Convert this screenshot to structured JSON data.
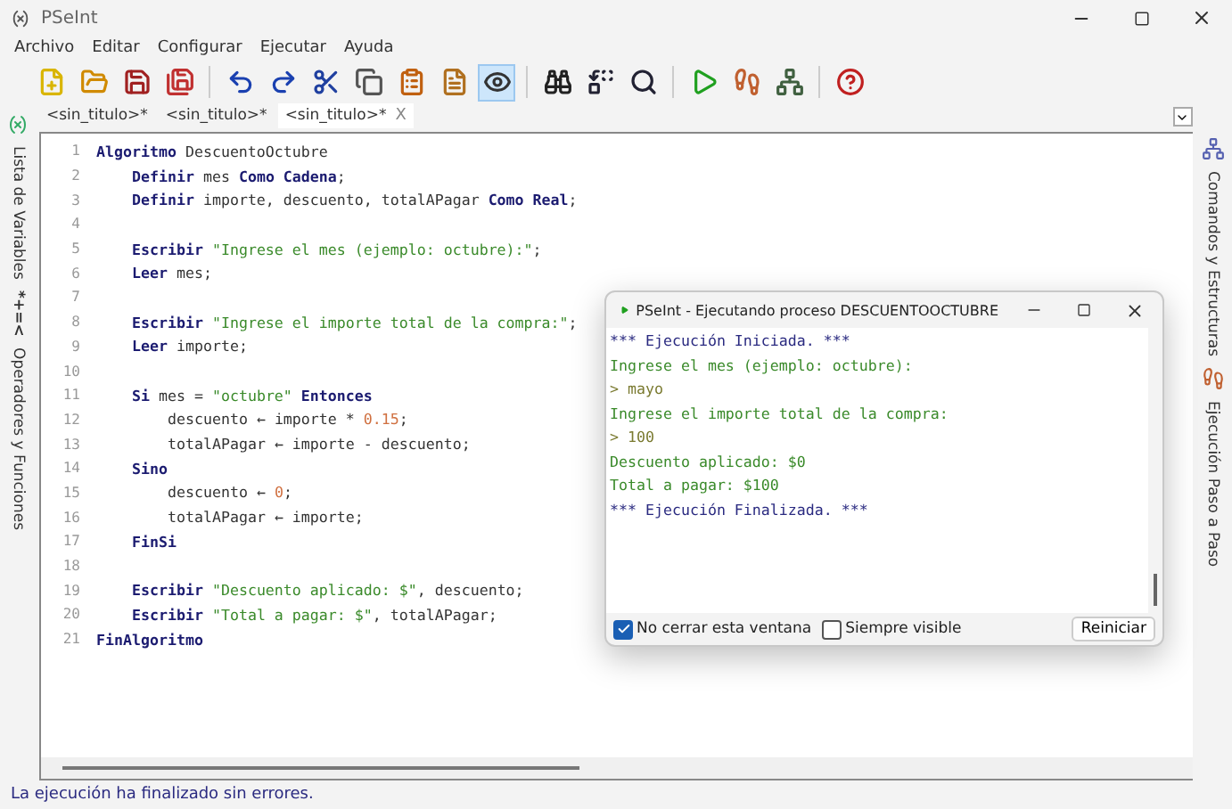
{
  "window": {
    "title": "PSeInt"
  },
  "menu": [
    "Archivo",
    "Editar",
    "Configurar",
    "Ejecutar",
    "Ayuda"
  ],
  "left_panel": {
    "tabs": [
      {
        "label": "Lista de Variables"
      },
      {
        "label": "Operadores y Funciones",
        "symbol": "*+=<"
      }
    ]
  },
  "right_panel": {
    "tabs": [
      "Comandos y Estructuras",
      "Ejecución Paso a Paso"
    ]
  },
  "editor_tabs": [
    {
      "label": "<sin_titulo>*",
      "selected": false
    },
    {
      "label": "<sin_titulo>*",
      "selected": false
    },
    {
      "label": "<sin_titulo>*",
      "selected": true,
      "close": "X"
    }
  ],
  "code": [
    {
      "number": "1",
      "tokens": [
        {
          "kind": "keyword",
          "text": "Algoritmo"
        },
        {
          "kind": "plain",
          "text": " DescuentoOctubre"
        }
      ],
      "children": [
        {
          "number": "2",
          "tokens": [
            {
              "kind": "keyword",
              "text": "Definir"
            },
            {
              "kind": "plain",
              "text": " mes "
            },
            {
              "kind": "keyword",
              "text": "Como Cadena"
            },
            {
              "kind": "plain",
              "text": ";"
            }
          ]
        },
        {
          "number": "3",
          "tokens": [
            {
              "kind": "keyword",
              "text": "Definir"
            },
            {
              "kind": "plain",
              "text": " importe, descuento, totalAPagar "
            },
            {
              "kind": "keyword",
              "text": "Como Real"
            },
            {
              "kind": "plain",
              "text": ";"
            }
          ]
        },
        {
          "number": "4"
        },
        {
          "number": "5",
          "tokens": [
            {
              "kind": "keyword",
              "text": "Escribir"
            },
            {
              "kind": "string",
              "text": " \"Ingrese el mes (ejemplo: octubre):\""
            },
            {
              "kind": "plain",
              "text": ";"
            }
          ]
        },
        {
          "number": "6",
          "tokens": [
            {
              "kind": "keyword",
              "text": "Leer"
            },
            {
              "kind": "plain",
              "text": " mes;"
            }
          ]
        },
        {
          "number": "7"
        },
        {
          "number": "8",
          "tokens": [
            {
              "kind": "keyword",
              "text": "Escribir"
            },
            {
              "kind": "string",
              "text": " \"Ingrese el importe total de la compra:\""
            },
            {
              "kind": "plain",
              "text": ";"
            }
          ]
        },
        {
          "number": "9",
          "tokens": [
            {
              "kind": "keyword",
              "text": "Leer"
            },
            {
              "kind": "plain",
              "text": " importe;"
            }
          ]
        },
        {
          "number": "10"
        },
        {
          "number": "11",
          "tokens": [
            {
              "kind": "keyword",
              "text": "Si"
            },
            {
              "kind": "plain",
              "text": " mes = "
            },
            {
              "kind": "string",
              "text": "\"octubre\""
            },
            {
              "kind": "keyword",
              "text": " Entonces"
            }
          ],
          "children": [
            {
              "number": "12",
              "tokens": [
                {
                  "kind": "plain",
                  "text": "descuento ← importe * "
                },
                {
                  "kind": "number",
                  "text": "0.15"
                },
                {
                  "kind": "plain",
                  "text": ";"
                }
              ]
            },
            {
              "number": "13",
              "tokens": [
                {
                  "kind": "plain",
                  "text": "totalAPagar ← importe - descuento;"
                }
              ]
            }
          ]
        },
        {
          "number": "14",
          "tokens": [
            {
              "kind": "keyword",
              "text": "Sino"
            }
          ],
          "children": [
            {
              "number": "15",
              "tokens": [
                {
                  "kind": "plain",
                  "text": "descuento ← "
                },
                {
                  "kind": "number",
                  "text": "0"
                },
                {
                  "kind": "plain",
                  "text": ";"
                }
              ]
            },
            {
              "number": "16",
              "tokens": [
                {
                  "kind": "plain",
                  "text": "totalAPagar ← importe;"
                }
              ]
            }
          ]
        },
        {
          "number": "17",
          "tokens": [
            {
              "kind": "keyword",
              "text": "FinSi"
            }
          ]
        },
        {
          "number": "18"
        },
        {
          "number": "19",
          "tokens": [
            {
              "kind": "keyword",
              "text": "Escribir"
            },
            {
              "kind": "string",
              "text": " \"Descuento aplicado: $\""
            },
            {
              "kind": "plain",
              "text": ", descuento;"
            }
          ]
        },
        {
          "number": "20",
          "tokens": [
            {
              "kind": "keyword",
              "text": "Escribir"
            },
            {
              "kind": "string",
              "text": " \"Total a pagar: $\""
            },
            {
              "kind": "plain",
              "text": ", totalAPagar;"
            }
          ]
        }
      ]
    },
    {
      "number": "21",
      "tokens": [
        {
          "kind": "keyword",
          "text": "FinAlgoritmo"
        }
      ]
    }
  ],
  "console": {
    "title": "PSeInt - Ejecutando proceso DESCUENTOOCTUBRE",
    "lines": [
      {
        "kind": "info",
        "text": "*** Ejecución Iniciada. ***"
      },
      {
        "kind": "output",
        "text": "Ingrese el mes (ejemplo: octubre):"
      },
      {
        "kind": "input",
        "text": "> mayo"
      },
      {
        "kind": "output",
        "text": "Ingrese el importe total de la compra:"
      },
      {
        "kind": "input",
        "text": "> 100"
      },
      {
        "kind": "output",
        "text": "Descuento aplicado: $0"
      },
      {
        "kind": "output",
        "text": "Total a pagar: $100"
      },
      {
        "kind": "info",
        "text": "*** Ejecución Finalizada. ***"
      }
    ],
    "options": [
      {
        "label": "No cerrar esta ventana",
        "checked": true
      },
      {
        "label": "Siempre visible",
        "checked": false
      }
    ],
    "button": "Reiniciar"
  },
  "status_bar": "La ejecución ha finalizado sin errores."
}
